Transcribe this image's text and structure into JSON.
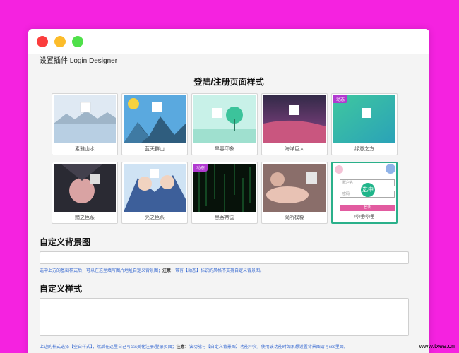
{
  "window": {
    "app_title": "设置插件 Login Designer",
    "section_title": "登陆/注册页面样式"
  },
  "templates": [
    {
      "label": "素雅山水",
      "tag": ""
    },
    {
      "label": "蓝天群山",
      "tag": ""
    },
    {
      "label": "早春印象",
      "tag": ""
    },
    {
      "label": "海洋巨人",
      "tag": ""
    },
    {
      "label": "绿意之方",
      "tag": "动态"
    },
    {
      "label": "黯之色系",
      "tag": ""
    },
    {
      "label": "亮之色系",
      "tag": ""
    },
    {
      "label": "黑客帝国",
      "tag": "动态"
    },
    {
      "label": "简听模糊",
      "tag": ""
    },
    {
      "label": "哔哩哔哩",
      "tag": "",
      "selected_badge": "选中",
      "user_placeholder": "账户名",
      "pass_placeholder": "密码",
      "button": "登录"
    }
  ],
  "custom_bg": {
    "heading": "自定义背景图",
    "hint_before": "选中上方的基础样式后，可以在这里填写图片地址自定义背景图；",
    "hint_note": "注意：",
    "hint_after": "带有【动态】标识的风格不支持自定义背景图。"
  },
  "custom_style": {
    "heading": "自定义样式",
    "hint_before": "上边的样式选择【空白样式】，然后在这里自己写css美化注册/登录页面；",
    "hint_note": "注意：",
    "hint_after": "该功能与【自定义背景图】功能冲突，使用该功能时如果想设置背景图请写css里面。"
  },
  "watermark": "www.txee.cn",
  "colors": {
    "background": "#f522e0",
    "selected_border": "#2ab08a",
    "tag": "#b03ad0",
    "hint_text": "#3a6bd1"
  }
}
